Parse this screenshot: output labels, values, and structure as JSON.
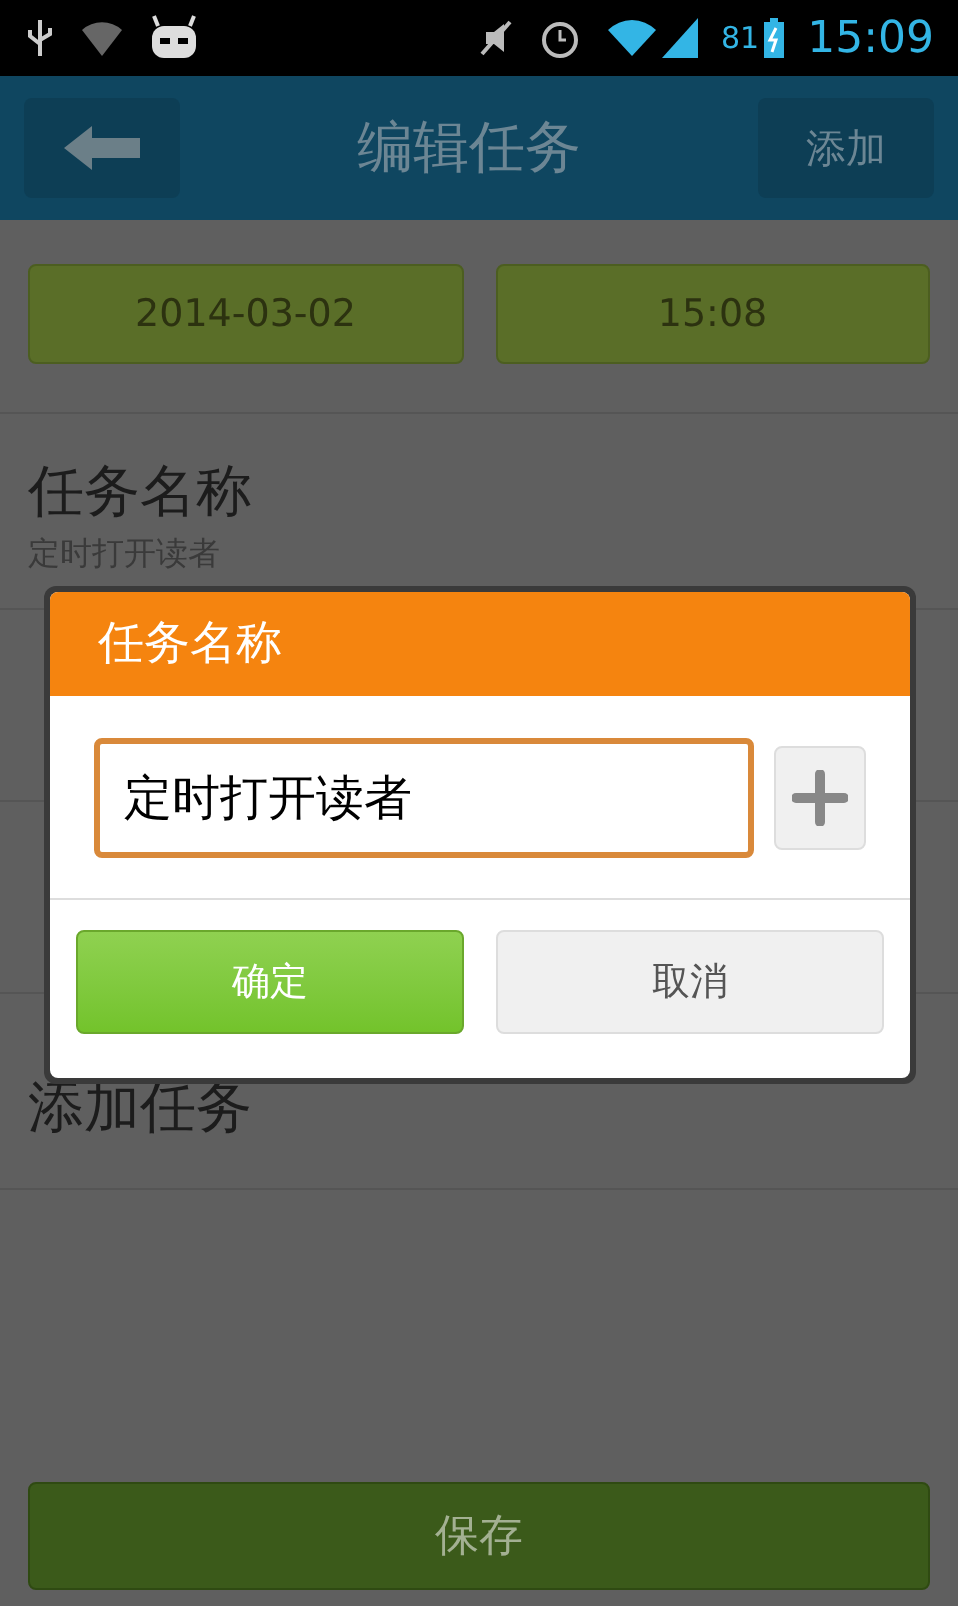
{
  "status_bar": {
    "battery": "81",
    "time": "15:09"
  },
  "header": {
    "title": "编辑任务",
    "action": "添加"
  },
  "date_button": "2014-03-02",
  "time_button": "15:08",
  "task_name_row": {
    "title": "任务名称",
    "subtitle": "定时打开读者"
  },
  "add_task_row": {
    "title": "添加任务"
  },
  "save_button": "保存",
  "dialog": {
    "title": "任务名称",
    "value": "定时打开读者",
    "confirm": "确定",
    "cancel": "取消"
  }
}
